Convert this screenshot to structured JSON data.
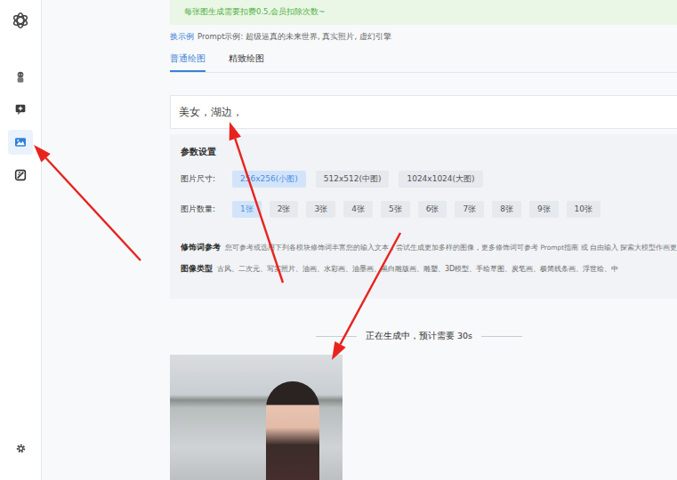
{
  "sidebar": {
    "items": [
      {
        "icon": "avatar",
        "selected": false
      },
      {
        "icon": "chat",
        "selected": false
      },
      {
        "icon": "image",
        "selected": true
      },
      {
        "icon": "mirror",
        "selected": false
      }
    ]
  },
  "banner": "每张图生成需要扣费0.5,会员扣除次数~",
  "example": {
    "link": "换示例",
    "text": "Prompt示例: 超级逼真的未来世界, 真实照片, 虚幻引擎"
  },
  "tabs": [
    {
      "label": "普通绘图",
      "selected": true
    },
    {
      "label": "精致绘图",
      "selected": false
    }
  ],
  "prompt": {
    "value": "美女，湖边，"
  },
  "params": {
    "title": "参数设置",
    "size": {
      "label": "图片尺寸:",
      "options": [
        {
          "label": "256x256(小图)",
          "selected": true
        },
        {
          "label": "512x512(中图)",
          "selected": false
        },
        {
          "label": "1024x1024(大图)",
          "selected": false
        }
      ]
    },
    "count": {
      "label": "图片数量:",
      "options": [
        {
          "label": "1张",
          "selected": true
        },
        {
          "label": "2张",
          "selected": false
        },
        {
          "label": "3张",
          "selected": false
        },
        {
          "label": "4张",
          "selected": false
        },
        {
          "label": "5张",
          "selected": false
        },
        {
          "label": "6张",
          "selected": false
        },
        {
          "label": "7张",
          "selected": false
        },
        {
          "label": "8张",
          "selected": false
        },
        {
          "label": "9张",
          "selected": false
        },
        {
          "label": "10张",
          "selected": false
        }
      ]
    },
    "modifiers": {
      "title": "修饰词参考",
      "text": "您可参考或选用下列各模块修饰词丰富您的输入文本，尝试生成更加多样的图像，更多修饰词可参考 Prompt指南 或 自由输入 探索大模型作画更"
    },
    "image_type": {
      "label": "图像类型",
      "text": "古风、二次元、写实照片、油画、水彩画、油墨画、黑白雕版画、雕塑、3D模型、手绘草图、炭笔画、极简线条画、浮世绘、中"
    }
  },
  "status": "正在生成中，预计需要 30s"
}
